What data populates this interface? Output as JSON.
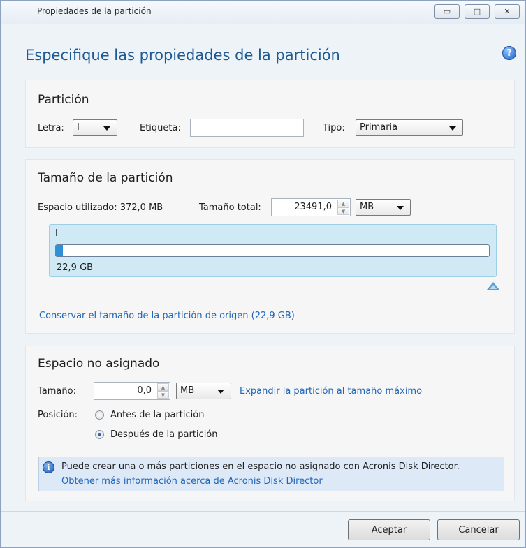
{
  "window": {
    "title": "Propiedades de la partición",
    "controls": {
      "minimize": "▭",
      "maximize": "□",
      "close": "✕"
    }
  },
  "heading": "Especifique las propiedades de la partición",
  "help_icon": "?",
  "particion": {
    "title": "Partición",
    "letra_label": "Letra:",
    "letra_value": "I",
    "etiqueta_label": "Etiqueta:",
    "etiqueta_value": "",
    "tipo_label": "Tipo:",
    "tipo_value": "Primaria"
  },
  "tamano": {
    "title": "Tamaño de la partición",
    "used_label": "Espacio utilizado: 372,0 MB",
    "total_label": "Tamaño total:",
    "total_value": "23491,0",
    "unit": "MB",
    "disk_letter": "I",
    "disk_size": "22,9 GB",
    "used_fraction": 0.016,
    "keep_link": "Conservar el tamaño de la partición de origen (22,9 GB)"
  },
  "unassigned": {
    "title": "Espacio no asignado",
    "size_label": "Tamaño:",
    "size_value": "0,0",
    "unit": "MB",
    "expand_link": "Expandir la partición al tamaño máximo",
    "position_label": "Posición:",
    "before_label": "Antes de la partición",
    "after_label": "Después de la partición",
    "selected": "after",
    "info_icon": "i",
    "info_text": "Puede crear una o más particiones en el espacio no asignado con Acronis Disk Director.",
    "info_link": "Obtener más información acerca de Acronis Disk Director"
  },
  "buttons": {
    "ok": "Aceptar",
    "cancel": "Cancelar"
  },
  "colors": {
    "accent": "#1d5a93",
    "link": "#2166b8",
    "bar_fill": "#2f8fd8",
    "diskmap_bg": "#cfeaf5"
  }
}
